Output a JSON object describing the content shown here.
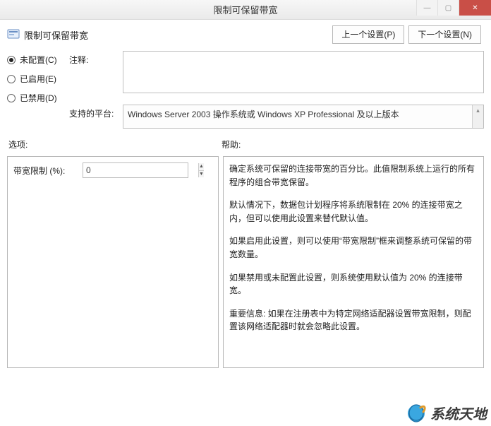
{
  "titlebar": {
    "title": "限制可保留带宽"
  },
  "header": {
    "setting_name": "限制可保留带宽",
    "prev_button": "上一个设置(P)",
    "next_button": "下一个设置(N)"
  },
  "radios": {
    "not_configured": "未配置(C)",
    "enabled": "已启用(E)",
    "disabled": "已禁用(D)",
    "selected": "not_configured"
  },
  "fields": {
    "comment_label": "注释:",
    "comment_value": "",
    "platform_label": "支持的平台:",
    "platform_value": "Windows Server 2003 操作系统或 Windows XP Professional 及以上版本"
  },
  "sections": {
    "options_label": "选项:",
    "help_label": "帮助:"
  },
  "options": {
    "bandwidth_label": "带宽限制 (%):",
    "bandwidth_value": "0"
  },
  "help": {
    "p1": "确定系统可保留的连接带宽的百分比。此值限制系统上运行的所有程序的组合带宽保留。",
    "p2": "默认情况下，数据包计划程序将系统限制在 20% 的连接带宽之内，但可以使用此设置来替代默认值。",
    "p3": "如果启用此设置，则可以使用“带宽限制”框来调整系统可保留的带宽数量。",
    "p4": "如果禁用或未配置此设置，则系统使用默认值为 20% 的连接带宽。",
    "p5": "重要信息: 如果在注册表中为特定网络适配器设置带宽限制，则配置该网络适配器时就会忽略此设置。"
  },
  "watermark": {
    "text": "系统天地"
  }
}
